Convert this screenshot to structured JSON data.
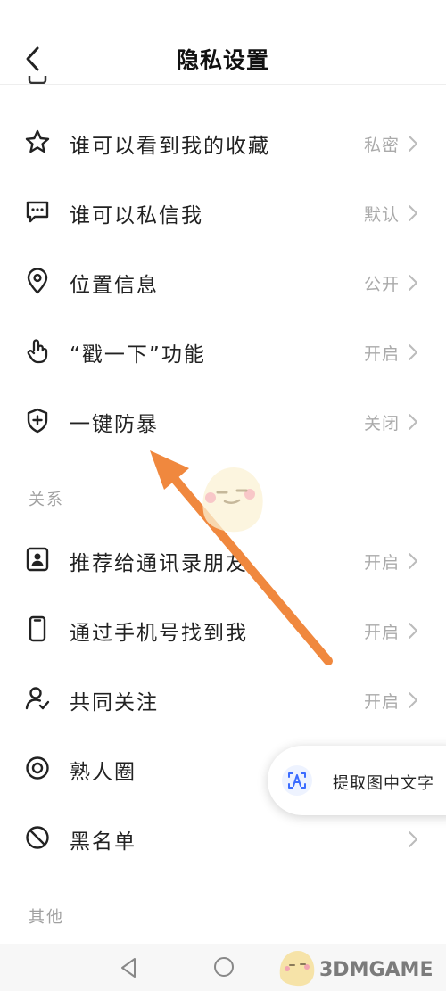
{
  "header": {
    "title": "隐私设置"
  },
  "sections": {
    "top_items": [
      {
        "label": "谁可以看到我的收藏",
        "value": "私密",
        "icon": "star-icon"
      },
      {
        "label": "谁可以私信我",
        "value": "默认",
        "icon": "message-icon"
      },
      {
        "label": "位置信息",
        "value": "公开",
        "icon": "location-icon"
      },
      {
        "label": "“戳一下”功能",
        "value": "开启",
        "icon": "tap-hand-icon"
      },
      {
        "label": "一键防暴",
        "value": "关闭",
        "icon": "shield-plus-icon"
      }
    ],
    "relation": {
      "title": "关系",
      "items": [
        {
          "label": "推荐给通讯录朋友",
          "value": "开启",
          "icon": "contact-card-icon"
        },
        {
          "label": "通过手机号找到我",
          "value": "开启",
          "icon": "phone-icon"
        },
        {
          "label": "共同关注",
          "value": "开启",
          "icon": "user-check-icon"
        },
        {
          "label": "熟人圈",
          "value": "",
          "icon": "circle-target-icon"
        },
        {
          "label": "黑名单",
          "value": "",
          "icon": "block-icon"
        }
      ]
    },
    "other": {
      "title": "其他"
    }
  },
  "ocr_button": {
    "label": "提取图中文字"
  },
  "watermark": {
    "text": "3DMGAME"
  },
  "colors": {
    "accent_arrow": "#f0883e",
    "value_gray": "#aaaaaa",
    "ocr_blue": "#3b6cff"
  }
}
